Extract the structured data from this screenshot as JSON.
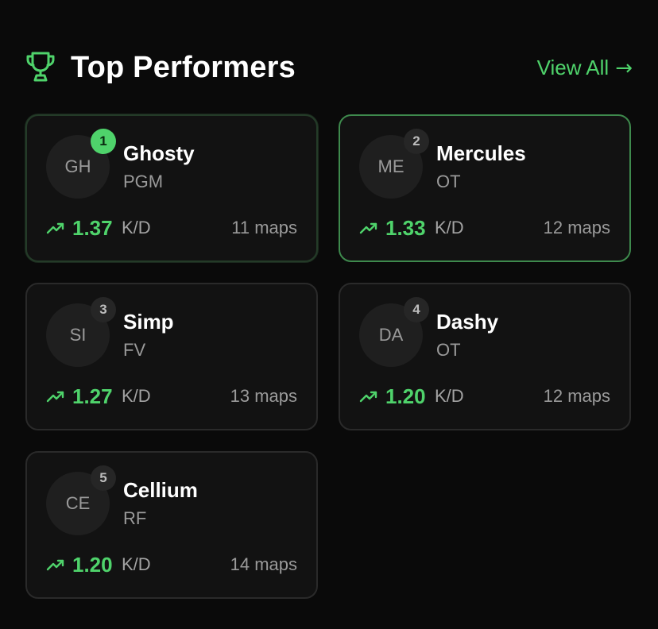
{
  "header": {
    "title": "Top Performers",
    "view_all": "View All",
    "view_all_arrow": "→",
    "icon": "trophy-icon"
  },
  "accent_color": "#4fd36b",
  "performers": [
    {
      "rank": "1",
      "initials": "GH",
      "name": "Ghosty",
      "team": "PGM",
      "kd": "1.37",
      "kd_label": "K/D",
      "maps": "11 maps"
    },
    {
      "rank": "2",
      "initials": "ME",
      "name": "Mercules",
      "team": "OT",
      "kd": "1.33",
      "kd_label": "K/D",
      "maps": "12 maps"
    },
    {
      "rank": "3",
      "initials": "SI",
      "name": "Simp",
      "team": "FV",
      "kd": "1.27",
      "kd_label": "K/D",
      "maps": "13 maps"
    },
    {
      "rank": "4",
      "initials": "DA",
      "name": "Dashy",
      "team": "OT",
      "kd": "1.20",
      "kd_label": "K/D",
      "maps": "12 maps"
    },
    {
      "rank": "5",
      "initials": "CE",
      "name": "Cellium",
      "team": "RF",
      "kd": "1.20",
      "kd_label": "K/D",
      "maps": "14 maps"
    }
  ]
}
